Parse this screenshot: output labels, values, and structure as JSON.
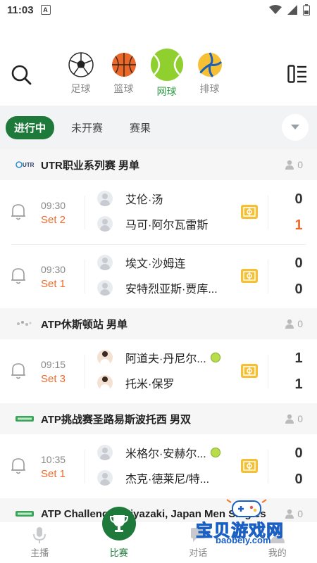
{
  "status_bar": {
    "time": "11:03",
    "app_badge": "A"
  },
  "sports": [
    {
      "label": "足球",
      "icon": "soccer-ball-icon",
      "active": false
    },
    {
      "label": "篮球",
      "icon": "basketball-icon",
      "active": false
    },
    {
      "label": "网球",
      "icon": "tennis-ball-icon",
      "active": true
    },
    {
      "label": "排球",
      "icon": "volleyball-icon",
      "active": false
    }
  ],
  "tabs": {
    "live": "进行中",
    "upcoming": "未开赛",
    "results": "赛果"
  },
  "leagues": [
    {
      "name": "UTR职业系列赛 男单",
      "logo_text": "UTR",
      "followers": "0",
      "matches": [
        {
          "time": "09:30",
          "set": "Set 2",
          "p1": "艾伦·汤",
          "p2": "马可·阿尔瓦雷斯",
          "score1": "0",
          "score2": "1"
        },
        {
          "time": "09:30",
          "set": "Set 1",
          "p1": "埃文·沙姆连",
          "p2": "安特烈亚斯·贾库...",
          "score1": "0",
          "score2": "0"
        }
      ]
    },
    {
      "name": "ATP休斯顿站 男单",
      "logo_text": "",
      "followers": "0",
      "matches": [
        {
          "time": "09:15",
          "set": "Set 3",
          "p1": "阿道夫·丹尼尔...",
          "p2": "托米·保罗",
          "score1": "1",
          "score2": "1"
        }
      ]
    },
    {
      "name": "ATP挑战赛圣路易斯波托西 男双",
      "logo_text": "",
      "followers": "0",
      "matches": [
        {
          "time": "10:35",
          "set": "Set 1",
          "p1": "米格尔·安赫尔...",
          "p2": "杰克·德莱尼/特...",
          "score1": "0",
          "score2": "0"
        }
      ]
    },
    {
      "name": "ATP Challenger Miyazaki, Japan Men Singles",
      "logo_text": "",
      "followers": "0",
      "matches": []
    }
  ],
  "bottom_nav": {
    "live": "主播",
    "matches": "比赛",
    "chat": "对话",
    "mine": "我的"
  },
  "watermark": {
    "title": "宝贝游戏网",
    "url": "baobeiy.com"
  },
  "colors": {
    "accent": "#1e7a3a",
    "live_orange": "#ee6a2b",
    "tennis_green": "#b9dd4a",
    "court_yellow": "#f5c034"
  }
}
